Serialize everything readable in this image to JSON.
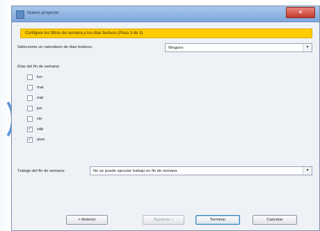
{
  "window": {
    "title": "Nuevo proyecto",
    "close_glyph": "✕"
  },
  "banner": {
    "text": "Configure los filtros de semana y los días festivos (Paso 3 de 3)"
  },
  "calendar": {
    "label": "Seleccione un calendario de días festivos:",
    "selected": "Ninguno"
  },
  "weekend": {
    "heading": "Días del fin de semana:",
    "days": [
      {
        "label": "lun",
        "checked": false
      },
      {
        "label": "mar",
        "checked": false
      },
      {
        "label": "mié",
        "checked": false
      },
      {
        "label": "jue",
        "checked": false
      },
      {
        "label": "vie",
        "checked": false
      },
      {
        "label": "sáb",
        "checked": true
      },
      {
        "label": "dom",
        "checked": true
      }
    ]
  },
  "weekend_work": {
    "label": "Trabajo del fin de semana:",
    "selected": "No se puede ejecutar trabajo en fin de semana"
  },
  "buttons": {
    "back": "< Anterior",
    "next": "Siguiente >",
    "finish": "Terminar",
    "cancel": "Cancelar"
  },
  "icons": {
    "dropdown": "chevron-down-icon",
    "check_glyph": "✓",
    "arrow_glyph": "▾"
  }
}
